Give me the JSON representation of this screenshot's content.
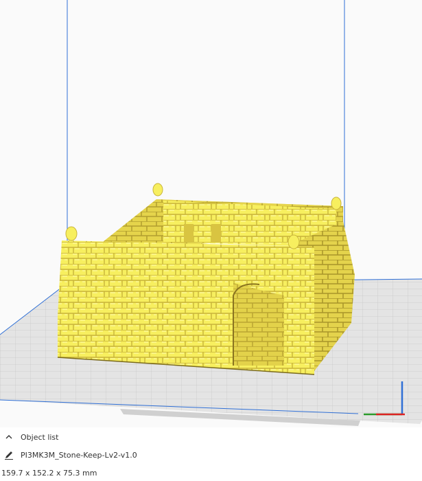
{
  "viewport": {
    "model_color": "#f7ef5f",
    "build_plate_color": "#dcdcdc",
    "volume_outline_color": "#2f6fd6",
    "icons": [
      "axis-gizmo-icon"
    ]
  },
  "object_panel": {
    "toggle_label": "Object list",
    "toggle_icon": "chevron-up-icon",
    "object_name": "PI3MK3M_Stone-Keep-Lv2-v1.0",
    "edit_icon": "pencil-icon",
    "dimensions": "159.7 x 152.2 x 75.3 mm"
  }
}
